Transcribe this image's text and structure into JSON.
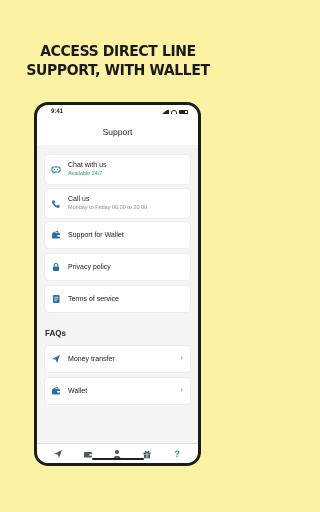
{
  "headline": {
    "line1": "ACCESS DIRECT LINE",
    "line2": "SUPPORT, WITH WALLET"
  },
  "status": {
    "time": "9:41"
  },
  "page": {
    "title": "Support"
  },
  "support_items": [
    {
      "label": "Chat with us",
      "sub": "Available 24/7",
      "icon": "chat-icon"
    },
    {
      "label": "Call us",
      "sub": "Monday to Friday 06:00 to 20:00",
      "icon": "phone-icon"
    },
    {
      "label": "Support for Wallet",
      "icon": "wallet-icon"
    },
    {
      "label": "Privacy policy",
      "icon": "lock-icon"
    },
    {
      "label": "Terms of service",
      "icon": "document-icon"
    }
  ],
  "faqs": {
    "heading": "FAQs",
    "items": [
      {
        "label": "Money transfer",
        "icon": "send-icon"
      },
      {
        "label": "Wallet",
        "icon": "wallet-icon"
      }
    ]
  },
  "tabbar": {
    "help_glyph": "?"
  },
  "colors": {
    "accent": "#1a9a8f",
    "available": "#2a9a6a",
    "background": "#fbf3a3"
  }
}
